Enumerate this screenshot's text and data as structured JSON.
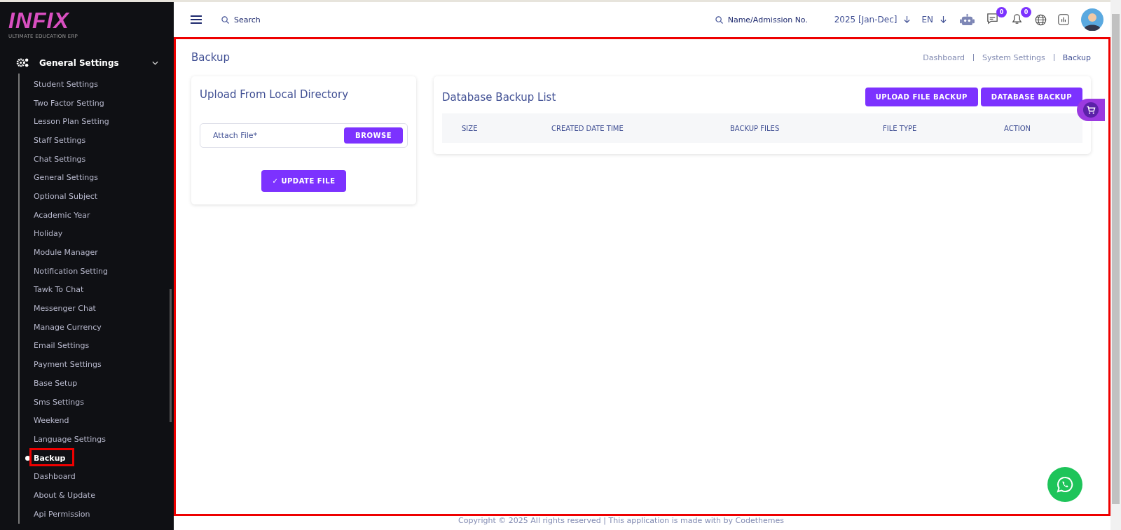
{
  "sidebar": {
    "logo": {
      "title": "INFIX",
      "subtitle": "ULTIMATE EDUCATION ERP"
    },
    "section": {
      "label": "General Settings",
      "expanded": true
    },
    "items": [
      {
        "label": "Student Settings",
        "selected": false,
        "highlighted": false
      },
      {
        "label": "Two Factor Setting",
        "selected": false,
        "highlighted": false
      },
      {
        "label": "Lesson Plan Setting",
        "selected": false,
        "highlighted": false
      },
      {
        "label": "Staff Settings",
        "selected": false,
        "highlighted": false
      },
      {
        "label": "Chat Settings",
        "selected": false,
        "highlighted": false
      },
      {
        "label": "General Settings",
        "selected": false,
        "highlighted": false
      },
      {
        "label": "Optional Subject",
        "selected": false,
        "highlighted": false
      },
      {
        "label": "Academic Year",
        "selected": false,
        "highlighted": false
      },
      {
        "label": "Holiday",
        "selected": false,
        "highlighted": false
      },
      {
        "label": "Module Manager",
        "selected": false,
        "highlighted": false
      },
      {
        "label": "Notification Setting",
        "selected": false,
        "highlighted": false
      },
      {
        "label": "Tawk To Chat",
        "selected": false,
        "highlighted": false
      },
      {
        "label": "Messenger Chat",
        "selected": false,
        "highlighted": false
      },
      {
        "label": "Manage Currency",
        "selected": false,
        "highlighted": false
      },
      {
        "label": "Email Settings",
        "selected": false,
        "highlighted": false
      },
      {
        "label": "Payment Settings",
        "selected": false,
        "highlighted": false
      },
      {
        "label": "Base Setup",
        "selected": false,
        "highlighted": false
      },
      {
        "label": "Sms Settings",
        "selected": false,
        "highlighted": false
      },
      {
        "label": "Weekend",
        "selected": false,
        "highlighted": false
      },
      {
        "label": "Language Settings",
        "selected": false,
        "highlighted": false
      },
      {
        "label": "Backup",
        "selected": true,
        "highlighted": true
      },
      {
        "label": "Dashboard",
        "selected": false,
        "highlighted": false
      },
      {
        "label": "About & Update",
        "selected": false,
        "highlighted": false
      },
      {
        "label": "Api Permission",
        "selected": false,
        "highlighted": false
      }
    ]
  },
  "topbar": {
    "search": {
      "placeholder": "Search"
    },
    "student_search": {
      "placeholder": "Name/Admission No."
    },
    "session": "2025 [Jan-Dec]",
    "language": "EN",
    "chat_badge": "0",
    "notification_badge": "0"
  },
  "main": {
    "highlighted": true,
    "title": "Backup",
    "breadcrumb": [
      "Dashboard",
      "System Settings",
      "Backup"
    ],
    "upload_card": {
      "title": "Upload From Local Directory",
      "file_field": {
        "placeholder": "Attach File*"
      },
      "browse_button": "BROWSE",
      "submit_button": "✓ UPDATE FILE"
    },
    "backup_card": {
      "title": "Database Backup List",
      "buttons": [
        "UPLOAD FILE BACKUP",
        "DATABASE BACKUP"
      ],
      "table": {
        "columns": [
          "SIZE",
          "CREATED DATE TIME",
          "BACKUP FILES",
          "FILE TYPE",
          "ACTION"
        ]
      }
    }
  },
  "footer": "Copyright © 2025 All rights reserved | This application is made with by Codethemes"
}
